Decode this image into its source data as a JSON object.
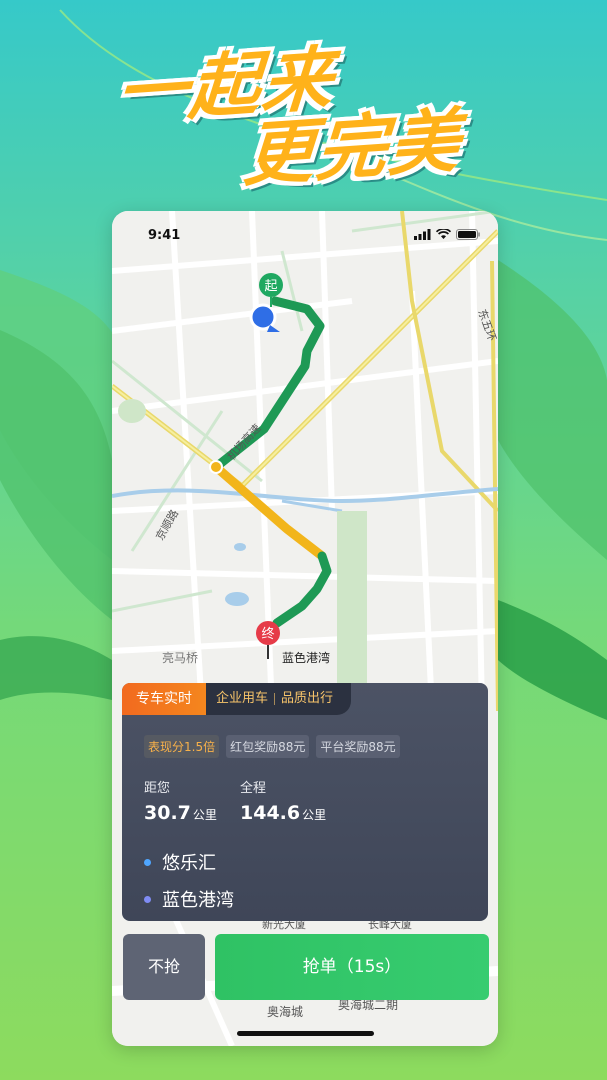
{
  "headline": {
    "line1": "一起来",
    "line2": "更完美"
  },
  "status_bar": {
    "time": "9:41",
    "icons": [
      "signal-icon",
      "wifi-icon",
      "battery-icon"
    ]
  },
  "map": {
    "start_marker": "起",
    "end_marker": "终",
    "destination_label": "蓝色港湾",
    "road_labels": [
      "机场高速",
      "京顺路",
      "东五环",
      "亮马桥",
      "奥海城",
      "奥海城二期",
      "新光大厦",
      "长峰大厦"
    ]
  },
  "order_panel": {
    "tabs": {
      "active": "专车实时",
      "secondary": [
        "企业用车",
        "品质出行"
      ]
    },
    "badges": [
      "表现分1.5倍",
      "红包奖励88元",
      "平台奖励88元"
    ],
    "distance_to_you": {
      "label": "距您",
      "value": "30.7",
      "unit": "公里"
    },
    "total_distance": {
      "label": "全程",
      "value": "144.6",
      "unit": "公里"
    },
    "pickup": "悠乐汇",
    "dropoff": "蓝色港湾"
  },
  "actions": {
    "skip": "不抢",
    "grab": "抢单（15s）"
  },
  "colors": {
    "accent_green": "#2fc264",
    "orange": "#f26a1f",
    "panel": "#4c5365",
    "route_green": "#1fa05a",
    "route_yellow": "#f2b51b"
  }
}
